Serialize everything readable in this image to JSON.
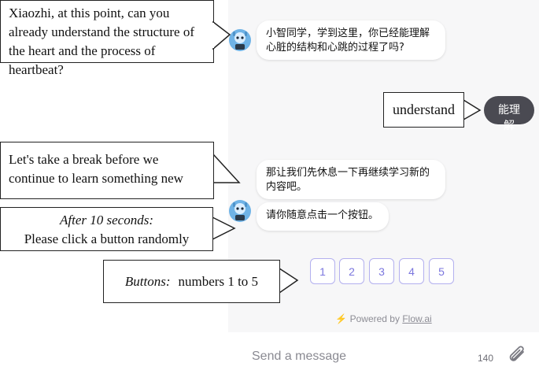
{
  "chat": {
    "messages": [
      {
        "from": "bot",
        "text": "小智同学，学到这里，你已经能理解心脏的结构和心跳的过程了吗?"
      },
      {
        "from": "user",
        "text": "能理解"
      },
      {
        "from": "bot",
        "text": "那让我们先休息一下再继续学习新的内容吧。"
      },
      {
        "from": "bot",
        "text": "请你随意点击一个按钮。"
      }
    ],
    "buttons": [
      "1",
      "2",
      "3",
      "4",
      "5"
    ],
    "powered_prefix": "Powered by",
    "powered_link": "Flow.ai"
  },
  "composer": {
    "placeholder": "Send a message",
    "char_count": "140"
  },
  "annotations": {
    "q1": "Xiaozhi, at this point, can you already understand the structure of the heart and the process of heartbeat?",
    "answer": "understand",
    "break": "Let's take a break before we continue to learn something new",
    "after_label": "After 10 seconds:",
    "after_text": "Please click a button randomly",
    "buttons_label": "Buttons:",
    "buttons_text": "numbers 1 to 5"
  },
  "colors": {
    "user_bubble": "#4a4a52",
    "button_accent": "#7b76de",
    "panel_bg": "#f7f7f8"
  },
  "icons": {
    "avatar": "robot-avatar-icon",
    "bolt": "lightning-icon",
    "attach": "paperclip-icon"
  }
}
